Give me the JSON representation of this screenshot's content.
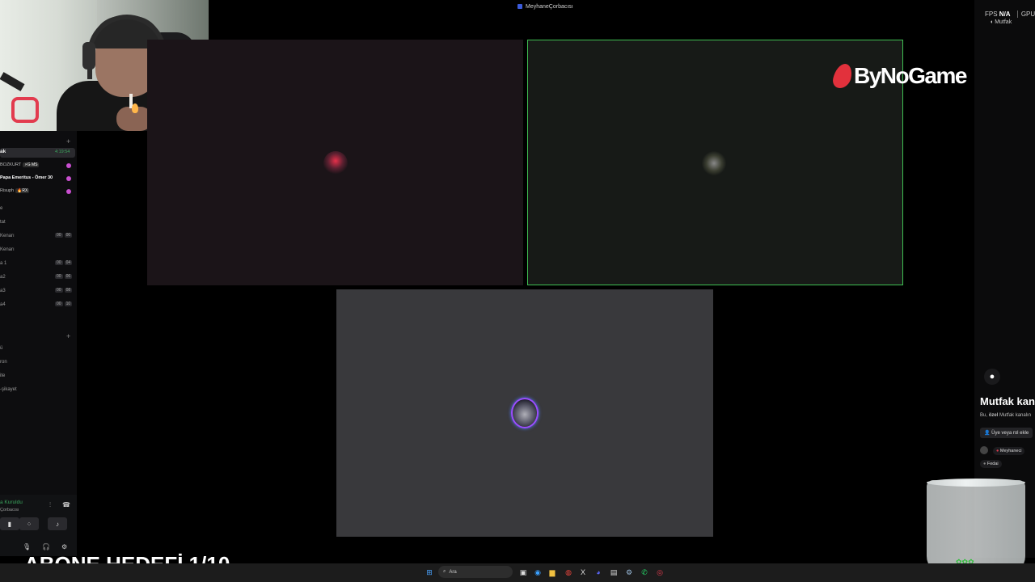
{
  "window": {
    "title": "MeyhaneÇorbacısı"
  },
  "sidebar": {
    "active_channel": {
      "name": "ak",
      "timer": "4:19:54"
    },
    "voice_users": [
      {
        "name": "BOZKURT",
        "badge": "⚡G MS"
      },
      {
        "name": "Papa Emeritus - Ömer 30",
        "badge": ""
      },
      {
        "name": "Risuph",
        "badge": "🔥RX"
      }
    ],
    "channels": [
      {
        "name": "e",
        "counts": []
      },
      {
        "name": "tat",
        "counts": []
      },
      {
        "name": "Kenarı",
        "counts": [
          "00",
          "00"
        ]
      },
      {
        "name": "Kenarı",
        "counts": []
      },
      {
        "name": "a 1",
        "counts": [
          "00",
          "04"
        ]
      },
      {
        "name": "a2",
        "counts": [
          "00",
          "06"
        ]
      },
      {
        "name": "a3",
        "counts": [
          "00",
          "08"
        ]
      },
      {
        "name": "a4",
        "counts": [
          "00",
          "10"
        ]
      }
    ],
    "text_channels": [
      "ü",
      "ron",
      "ite",
      "-şikayet"
    ],
    "status": {
      "label": "a Kuruldu",
      "server": "Çorbacısı"
    }
  },
  "logo": {
    "text": "ByNoGame"
  },
  "right_panel": {
    "fps_label": "FPS",
    "fps_value": "N/A",
    "gpu_label": "GPU",
    "channel_top": "Mutfak",
    "title": "Mutfak kan",
    "desc_prefix": "Bu, ",
    "desc_bold": "özel",
    "desc_suffix": " Mutfak kanalın",
    "add_button": "Üye veya rol ekle",
    "roles": [
      "Meyhaneci",
      "Fedai"
    ]
  },
  "overlay": {
    "goal_text": "ABONE HEDEFİ 1/10"
  },
  "taskbar": {
    "search_placeholder": "Ara"
  }
}
